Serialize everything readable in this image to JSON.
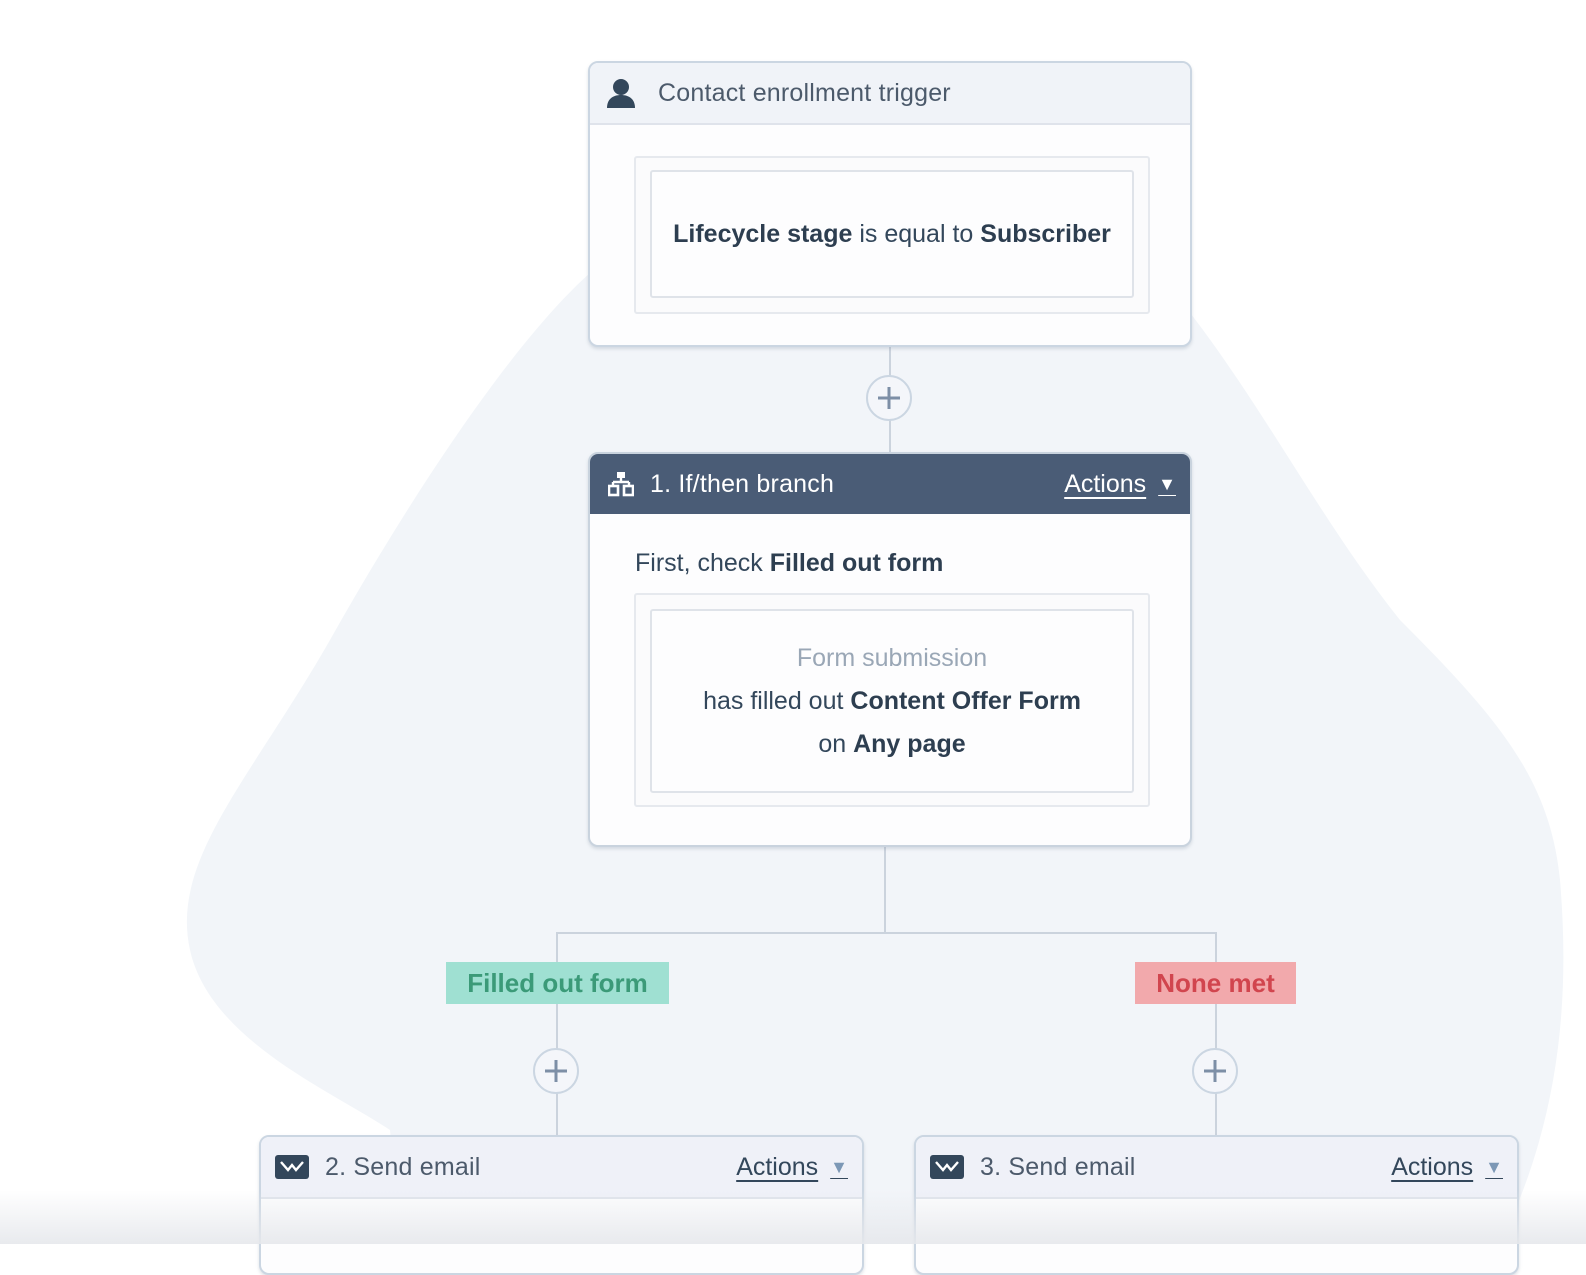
{
  "colors": {
    "branch_header": "#4a5c76",
    "filled_tag_bg": "#9fe0d2",
    "filled_tag_text": "#3b9a78",
    "none_tag_bg": "#f2a9ac",
    "none_tag_text": "#d1454e",
    "connector": "#cbd3dd"
  },
  "trigger": {
    "icon": "contact-icon",
    "title": "Contact enrollment trigger",
    "condition": {
      "property": "Lifecycle stage",
      "operator": "is equal to",
      "value": "Subscriber"
    }
  },
  "add_step_buttons": [
    {
      "icon": "plus-icon",
      "position": "after-trigger"
    },
    {
      "icon": "plus-icon",
      "position": "filled-out-form-branch"
    },
    {
      "icon": "plus-icon",
      "position": "none-met-branch"
    }
  ],
  "branch": {
    "icon": "branch-icon",
    "title": "1. If/then branch",
    "actions_label": "Actions",
    "first_check_prefix": "First, check",
    "first_check_value": "Filled out form",
    "condition": {
      "category": "Form submission",
      "verb": "has filled out",
      "form": "Content Offer Form",
      "page_prefix": "on",
      "page": "Any page"
    },
    "outcomes": [
      {
        "label": "Filled out form"
      },
      {
        "label": "None met"
      }
    ]
  },
  "email_actions": [
    {
      "icon": "email-icon",
      "title": "2. Send email",
      "actions_label": "Actions"
    },
    {
      "icon": "email-icon",
      "title": "3. Send email",
      "actions_label": "Actions"
    }
  ]
}
